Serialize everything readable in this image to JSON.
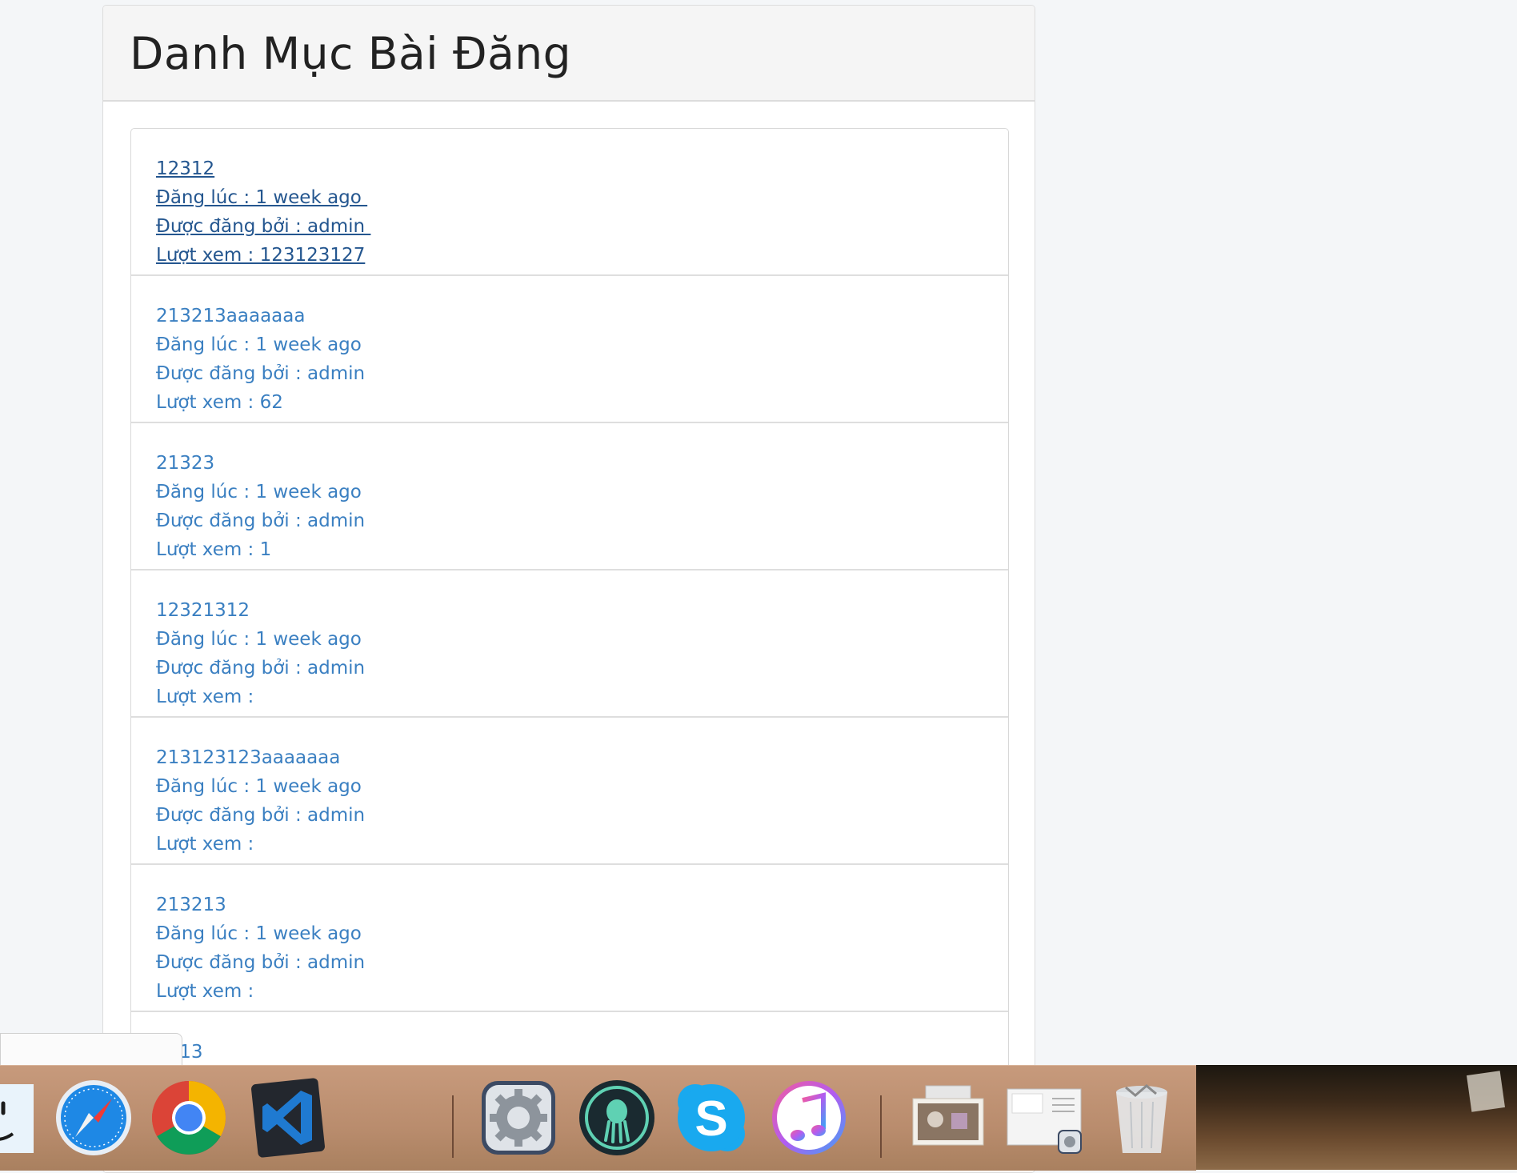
{
  "panel": {
    "title": "Danh Mục Bài Đăng"
  },
  "posts": [
    {
      "title": "12312",
      "posted_at": "Đăng lúc : 1 week ago ",
      "author": "Được đăng bởi : admin ",
      "views": "Lượt xem : 123123127"
    },
    {
      "title": "213213aaaaaaa",
      "posted_at": "Đăng lúc : 1 week ago",
      "author": "Được đăng bởi : admin",
      "views": "Lượt xem : 62"
    },
    {
      "title": "21323",
      "posted_at": "Đăng lúc : 1 week ago",
      "author": "Được đăng bởi : admin",
      "views": "Lượt xem : 1"
    },
    {
      "title": "12321312",
      "posted_at": "Đăng lúc : 1 week ago",
      "author": "Được đăng bởi : admin",
      "views": "Lượt xem :"
    },
    {
      "title": "213123123aaaaaaa",
      "posted_at": "Đăng lúc : 1 week ago",
      "author": "Được đăng bởi : admin",
      "views": "Lượt xem :"
    },
    {
      "title": "213213",
      "posted_at": "Đăng lúc : 1 week ago",
      "author": "Được đăng bởi : admin",
      "views": "Lượt xem :"
    },
    {
      "title": "3213",
      "posted_at": "",
      "author": "",
      "views": ""
    }
  ],
  "dock": {
    "items": [
      "finder-icon",
      "safari-icon",
      "chrome-icon",
      "vscode-icon",
      "system-preferences-icon",
      "gitkraken-icon",
      "skype-icon",
      "itunes-icon",
      "downloads-stack-icon",
      "screenshot-stack-icon",
      "trash-icon"
    ]
  },
  "colors": {
    "link": "#3a7fc1",
    "link_hover": "#24568f",
    "heading_bg": "#f5f5f5"
  }
}
